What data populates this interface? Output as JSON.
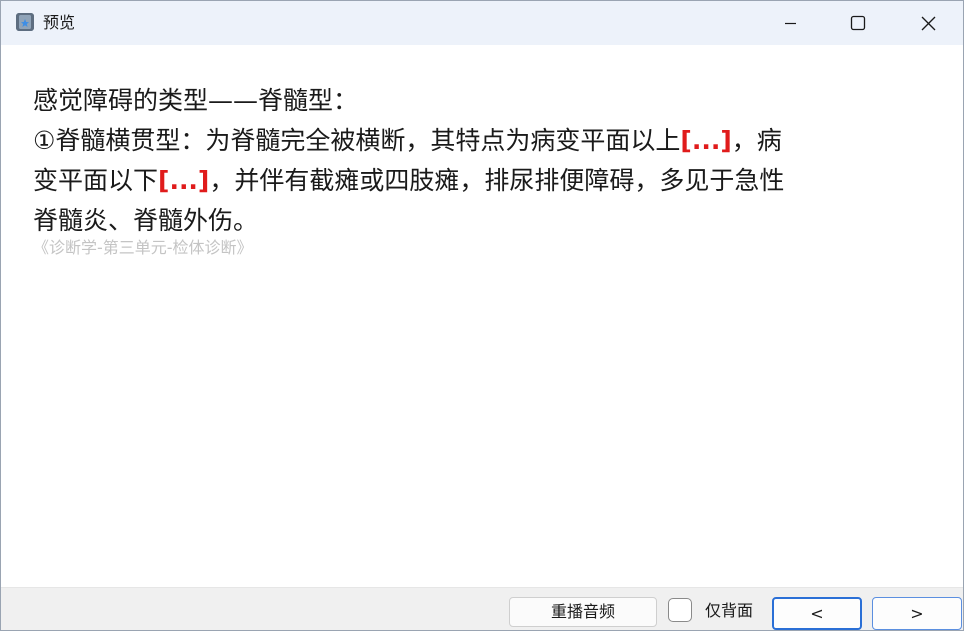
{
  "window": {
    "title": "预览",
    "accent_color": "#2a6fd6"
  },
  "card": {
    "line1": "感觉障碍的类型——脊髓型：",
    "line2_prefix": "①脊髓横贯型：为脊髓完全被横断，其特点为病变平面以上",
    "cloze1": "[...]",
    "line2_suffix": "，病",
    "line3_prefix": "变平面以下",
    "cloze2": "[...]",
    "line3_suffix": "，并伴有截瘫或四肢瘫，排尿排便障碍，多见于急性",
    "line4": "脊髓炎、脊髓外伤。",
    "source": "《诊断学-第三单元-检体诊断》",
    "cloze_color": "#e01b1b"
  },
  "toolbar": {
    "replay_label": "重播音频",
    "back_only_label": "仅背面",
    "back_only_checked": false,
    "prev_label": "<",
    "next_label": ">"
  }
}
